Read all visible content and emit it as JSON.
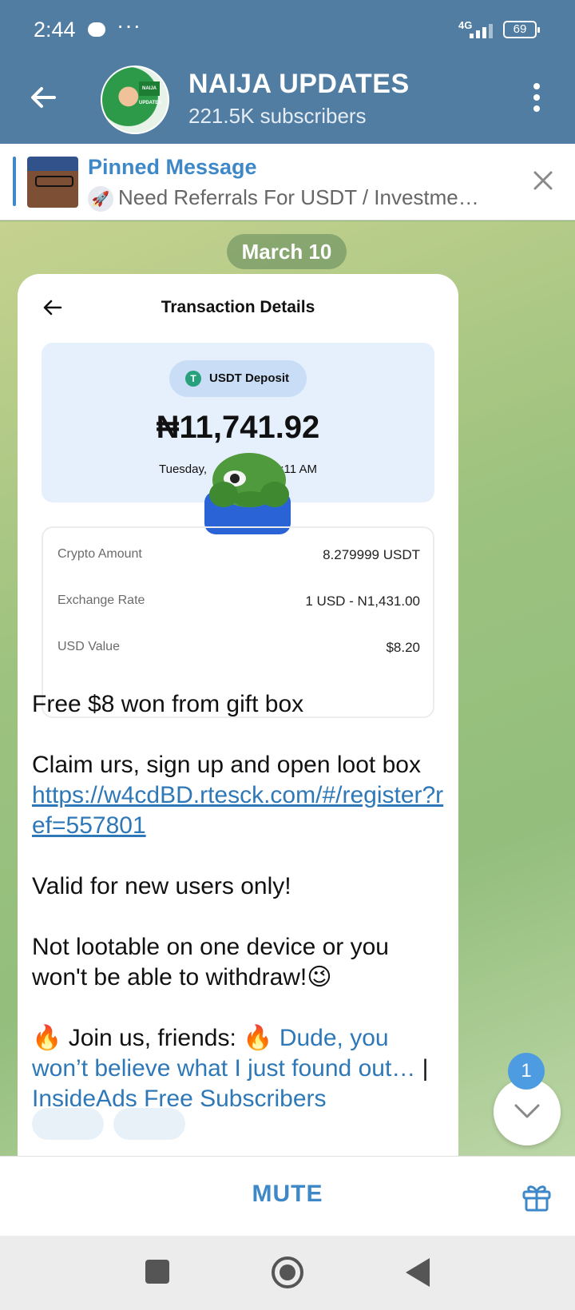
{
  "status": {
    "time": "2:44",
    "network": "4G",
    "battery": "69"
  },
  "header": {
    "title": "NAIJA UPDATES",
    "subtitle": "221.5K subscribers",
    "avatar_text": "NAIJA UPDATES"
  },
  "pinned": {
    "label": "Pinned Message",
    "preview": "Need Referrals For USDT / Investme…"
  },
  "chat": {
    "date": "March 10",
    "screenshot": {
      "title": "Transaction Details",
      "badge": "USDT Deposit",
      "amount": "₦11,741.92",
      "date_left": "Tuesday,",
      "date_right": ":11 AM",
      "rows": [
        {
          "key": "Crypto Amount",
          "value": "8.279999 USDT"
        },
        {
          "key": "Exchange Rate",
          "value": "1 USD - N1,431.00"
        },
        {
          "key": "USD Value",
          "value": "$8.20"
        }
      ]
    },
    "message": {
      "line1": "Free $8 won from gift box",
      "line2": "Claim urs, sign up and open loot box",
      "link": "https://w4cdBD.rtesck.com/#/register?ref=557801",
      "line3": "Valid for new users only!",
      "line4": "Not lootable on one device or you won't be able to withdraw!😉",
      "join_prefix": "🔥 Join us, friends: 🔥",
      "join_link": "Dude, you won’t believe what I just found out…",
      "join_sep": "|",
      "join_link2": "InsideAds Free Subscribers"
    },
    "unread_count": "1"
  },
  "bottom": {
    "mute_label": "MUTE"
  },
  "colors": {
    "header": "#517da2",
    "accent": "#3e88c7"
  }
}
